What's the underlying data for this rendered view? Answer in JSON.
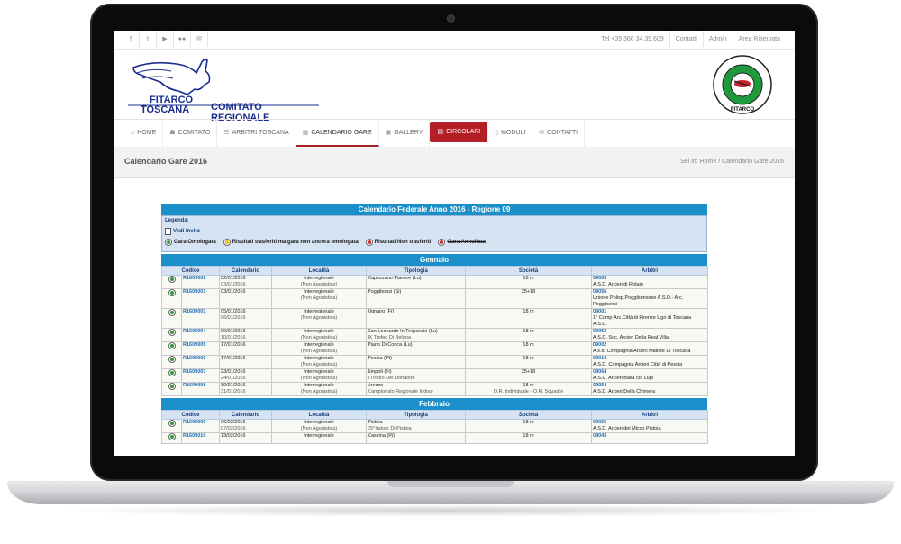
{
  "topbar": {
    "social_icons": [
      "facebook-icon",
      "twitter-icon",
      "youtube-icon",
      "flickr-icon",
      "mail-icon"
    ],
    "phone": "Tel +39 366 34.39.609",
    "links": [
      "Contatti",
      "Admin",
      "Area Riservata"
    ]
  },
  "header": {
    "brand_line1": "FITARCO",
    "brand_line2": "TOSCANA",
    "brand_line3": "COMITATO REGIONALE",
    "seal_text": "FEDERAZIONE ITALIANA TIRO CON L'ARCO",
    "seal_name": "FITARCO"
  },
  "nav": {
    "items": [
      {
        "label": "HOME",
        "icon": "home-icon"
      },
      {
        "label": "COMITATO",
        "icon": "group-icon"
      },
      {
        "label": "ARBITRI TOSCANA",
        "icon": "list-icon"
      },
      {
        "label": "CALENDARIO GARE",
        "icon": "calendar-icon"
      },
      {
        "label": "GALLERY",
        "icon": "image-icon"
      },
      {
        "label": "CIRCOLARI",
        "icon": "document-icon"
      },
      {
        "label": "MODULI",
        "icon": "file-icon"
      },
      {
        "label": "CONTATTI",
        "icon": "mail-icon"
      }
    ],
    "active_index": 3,
    "highlight_index": 5
  },
  "page": {
    "title": "Calendario Gare 2016",
    "breadcrumb_prefix": "Sei in:",
    "breadcrumb_home": "Home",
    "breadcrumb_sep": "/",
    "breadcrumb_current": "Calendario Gare 2016"
  },
  "calendar": {
    "title": "Calendario Federale Anno 2016 - Regione 09",
    "legend": {
      "heading": "Legenda:",
      "vedi_invito": "Vedi Invito",
      "gara_omologata": "Gara Omologata",
      "risultati_non_omologata": "Risultati trasferiti ma gara non ancora omologata",
      "risultati_non_trasferiti": "Risultati Non trasferiti",
      "gara_annullata": "Gara Annullata",
      "colors": {
        "omologata": "#2e9e3a",
        "pending": "#e7c019",
        "not_transferred": "#d3202a",
        "annullata": "#d3202a"
      }
    },
    "columns": [
      "Codice",
      "Data",
      "Calendario",
      "Località",
      "Tipologia",
      "Società",
      "Arbitri"
    ],
    "months": [
      {
        "name": "Gennaio",
        "rows": [
          {
            "code": "R1609002",
            "dates": [
              "02/01/2016",
              "03/01/2016"
            ],
            "cal": [
              "Interregionale",
              "(Non Agonistica)"
            ],
            "loc": [
              "Capezzano Pianore (Lu)",
              ""
            ],
            "tip": [
              "18 m",
              ""
            ],
            "soc_code": "09005",
            "soc": [
              "A.S.D. Arcieri di Rotaio"
            ],
            "arb": [
              "Cesetti Alessio"
            ]
          },
          {
            "code": "R1609001",
            "dates": [
              "03/01/2016"
            ],
            "cal": [
              "Interregionale",
              "(Non Agonistica)"
            ],
            "loc": [
              "Poggibonsi (Si)",
              ""
            ],
            "tip": [
              "25+18",
              ""
            ],
            "soc_code": "09056",
            "soc": [
              "Unione Polisp.Poggibonsese A.S.D.- Arc.",
              "Poggibonsi"
            ],
            "arb": [
              "Del Freo Fabrizio"
            ]
          },
          {
            "code": "R1609003",
            "dates": [
              "05/01/2016",
              "06/01/2016"
            ],
            "cal": [
              "Interregionale",
              "(Non Agonistica)"
            ],
            "loc": [
              "Ugnano (Fi)",
              ""
            ],
            "tip": [
              "18 m",
              ""
            ],
            "soc_code": "09001",
            "soc": [
              "1° Comp.Arc.Città di Firenze Ugo di Toscana",
              "A.S.D."
            ],
            "arb": [
              "DE PASCALIS SALVATORE"
            ]
          },
          {
            "code": "R1609004",
            "dates": [
              "09/01/2016",
              "10/01/2016"
            ],
            "cal": [
              "Interregionale",
              "(Non Agonistica)"
            ],
            "loc": [
              "San Leonardo In Treponzio (Lu)",
              "IX Trofeo Di Befana"
            ],
            "tip": [
              "18 m",
              ""
            ],
            "soc_code": "09053",
            "soc": [
              "A.S.D. Soc. Arcieri Della Real Villa"
            ],
            "arb": [
              "Dini David"
            ]
          },
          {
            "code": "R1609005",
            "dates": [
              "17/01/2016"
            ],
            "cal": [
              "Interregionale",
              "(Non Agonistica)"
            ],
            "loc": [
              "Piano Di Conca (Lu)",
              ""
            ],
            "tip": [
              "18 m",
              ""
            ],
            "soc_code": "09002",
            "soc": [
              "A.s.d. Compagnia Arcieri Matilde Di Toscana"
            ],
            "arb": [
              "Cesari Marco"
            ]
          },
          {
            "code": "R1609000",
            "dates": [
              "17/01/2016"
            ],
            "cal": [
              "Interregionale",
              "(Non Agonistica)"
            ],
            "loc": [
              "Pescia (Pt)",
              ""
            ],
            "tip": [
              "18 m",
              ""
            ],
            "soc_code": "09014",
            "soc": [
              "A.S.D. Compagnia Arcieri Città di Pescia"
            ],
            "arb": [
              "Tassini Luciano"
            ]
          },
          {
            "code": "R1609007",
            "dates": [
              "23/01/2016",
              "24/01/2016"
            ],
            "cal": [
              "Interregionale",
              "(Non Agonistica)"
            ],
            "loc": [
              "Empoli (Fi)",
              "I Trofeo Del Donatore"
            ],
            "tip": [
              "25+18",
              ""
            ],
            "soc_code": "09064",
            "soc": [
              "A.S.D. Arcieri Balla coi Lupi"
            ],
            "arb": [
              "PISANO CIRO"
            ]
          },
          {
            "code": "R1609008",
            "dates": [
              "30/01/2016",
              "31/01/2016"
            ],
            "cal": [
              "Interregionale",
              "(Non Agonistica)"
            ],
            "loc": [
              "Arezzo",
              "Campionato Regionale Indoor"
            ],
            "tip": [
              "18 m",
              "O.R. Individuale - O.R. Squadre"
            ],
            "soc_code": "09054",
            "soc": [
              "A.S.D. Arcieri Della Chimera"
            ],
            "arb": [
              "Tassini Luciano",
              "Landucci Paolo"
            ]
          }
        ]
      },
      {
        "name": "Febbraio",
        "rows": [
          {
            "code": "R1609009",
            "dates": [
              "06/02/2016",
              "07/02/2016"
            ],
            "cal": [
              "Interregionale",
              "(Non Agonistica)"
            ],
            "loc": [
              "Pistoia",
              "25°Indoor Di Pistoia"
            ],
            "tip": [
              "18 m",
              ""
            ],
            "soc_code": "09065",
            "soc": [
              "A.S.D. Arcieri del Micco Pistoia"
            ],
            "arb": [
              "DE PASCALIS SALVATORE"
            ]
          },
          {
            "code": "R1609010",
            "dates": [
              "13/02/2016"
            ],
            "cal": [
              "Interregionale",
              ""
            ],
            "loc": [
              "Cascina (Pi)",
              ""
            ],
            "tip": [
              "18 m",
              ""
            ],
            "soc_code": "09043",
            "soc": [
              ""
            ],
            "arb": [
              "PISANO CIRO"
            ]
          }
        ]
      }
    ]
  }
}
